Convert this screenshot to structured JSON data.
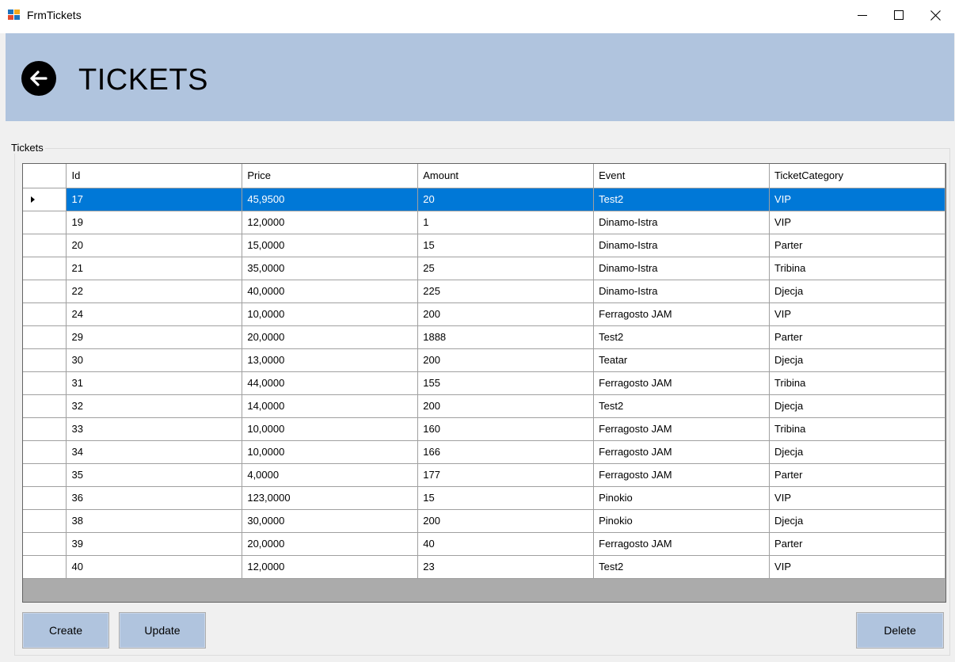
{
  "window": {
    "title": "FrmTickets"
  },
  "header": {
    "title": "TICKETS"
  },
  "group": {
    "label": "Tickets"
  },
  "grid": {
    "columns": [
      "Id",
      "Price",
      "Amount",
      "Event",
      "TicketCategory"
    ],
    "selected_index": 0,
    "rows": [
      [
        "17",
        "45,9500",
        "20",
        "Test2",
        "VIP"
      ],
      [
        "19",
        "12,0000",
        "1",
        "Dinamo-Istra",
        "VIP"
      ],
      [
        "20",
        "15,0000",
        "15",
        "Dinamo-Istra",
        "Parter"
      ],
      [
        "21",
        "35,0000",
        "25",
        "Dinamo-Istra",
        "Tribina"
      ],
      [
        "22",
        "40,0000",
        "225",
        "Dinamo-Istra",
        "Djecja"
      ],
      [
        "24",
        "10,0000",
        "200",
        "Ferragosto JAM",
        "VIP"
      ],
      [
        "29",
        "20,0000",
        "1888",
        "Test2",
        "Parter"
      ],
      [
        "30",
        "13,0000",
        "200",
        "Teatar",
        "Djecja"
      ],
      [
        "31",
        "44,0000",
        "155",
        "Ferragosto JAM",
        "Tribina"
      ],
      [
        "32",
        "14,0000",
        "200",
        "Test2",
        "Djecja"
      ],
      [
        "33",
        "10,0000",
        "160",
        "Ferragosto JAM",
        "Tribina"
      ],
      [
        "34",
        "10,0000",
        "166",
        "Ferragosto JAM",
        "Djecja"
      ],
      [
        "35",
        "4,0000",
        "177",
        "Ferragosto JAM",
        "Parter"
      ],
      [
        "36",
        "123,0000",
        "15",
        "Pinokio",
        "VIP"
      ],
      [
        "38",
        "30,0000",
        "200",
        "Pinokio",
        "Djecja"
      ],
      [
        "39",
        "20,0000",
        "40",
        "Ferragosto JAM",
        "Parter"
      ],
      [
        "40",
        "12,0000",
        "23",
        "Test2",
        "VIP"
      ]
    ]
  },
  "buttons": {
    "create": "Create",
    "update": "Update",
    "delete": "Delete"
  },
  "icons": {
    "app": "app-window-icon",
    "back": "back-arrow-icon",
    "minimize": "minimize-icon",
    "maximize": "maximize-icon",
    "close": "close-icon",
    "row_indicator": "current-row-arrow-icon"
  },
  "colors": {
    "header_bg": "#b0c4de",
    "button_bg": "#b0c4de",
    "selection": "#0078d7",
    "window_bg": "#f0f0f0"
  }
}
